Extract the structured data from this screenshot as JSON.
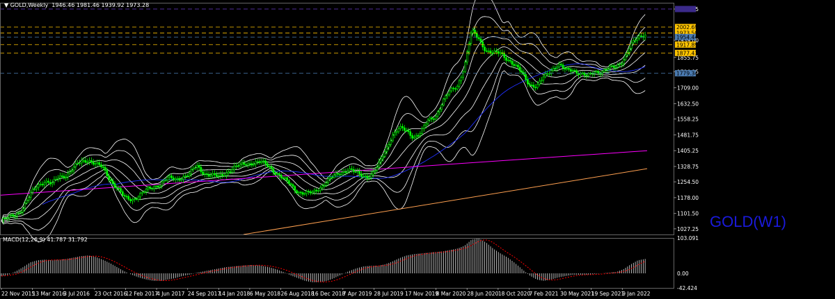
{
  "window": {
    "title": "GOLD,Weekly",
    "ohlc": "1946.46 1981.46 1939.92 1973.28",
    "watermark": "GOLD(W1)"
  },
  "colors": {
    "background": "#000000",
    "candle": "#00ff00",
    "bands": "#ffffff",
    "ma_blue": "#2030ff",
    "ma_magenta": "#ff00ff",
    "ma_orange": "#ffa050",
    "level_line": "#ffc400",
    "level_blue": "#4a7ab0",
    "macd_hist": "#c8c8c8",
    "macd_signal": "#ff0000"
  },
  "chart_data": [
    {
      "type": "candlestick",
      "title": "GOLD,Weekly 1946.46 1981.46 1939.92 1973.28",
      "ylim": [
        1000,
        2120
      ],
      "y_ticks": [
        "2089.75",
        "1939.00",
        "1855.75",
        "1786.25",
        "1709.00",
        "1632.50",
        "1558.25",
        "1481.75",
        "1405.25",
        "1328.75",
        "1254.50",
        "1178.00",
        "1101.50",
        "1027.25"
      ],
      "x_ticks": [
        "22 Nov 2015",
        "13 Mar 2016",
        "3 Jul 2016",
        "23 Oct 2016",
        "12 Feb 2017",
        "4 Jun 2017",
        "24 Sep 2017",
        "14 Jan 2018",
        "6 May 2018",
        "26 Aug 2018",
        "16 Dec 2018",
        "7 Apr 2019",
        "28 Jul 2019",
        "17 Nov 2019",
        "8 Mar 2020",
        "28 Jun 2020",
        "18 Oct 2020",
        "7 Feb 2021",
        "30 May 2021",
        "19 Sep 2021",
        "9 Jan 2022"
      ],
      "series_close": [
        1065,
        1080,
        1100,
        1130,
        1190,
        1240,
        1260,
        1240,
        1280,
        1290,
        1320,
        1350,
        1365,
        1340,
        1320,
        1270,
        1225,
        1175,
        1170,
        1190,
        1210,
        1230,
        1250,
        1270,
        1265,
        1280,
        1290,
        1330,
        1300,
        1285,
        1275,
        1300,
        1320,
        1330,
        1345,
        1350,
        1345,
        1330,
        1300,
        1265,
        1240,
        1210,
        1195,
        1200,
        1230,
        1255,
        1280,
        1305,
        1315,
        1295,
        1285,
        1285,
        1320,
        1400,
        1480,
        1510,
        1500,
        1475,
        1490,
        1550,
        1575,
        1640,
        1690,
        1720,
        1810,
        1980,
        1950,
        1890,
        1870,
        1880,
        1850,
        1810,
        1780,
        1730,
        1710,
        1760,
        1800,
        1820,
        1790,
        1800,
        1780,
        1760,
        1790,
        1790,
        1800,
        1810,
        1850,
        1910,
        1950,
        1973
      ],
      "price_levels": [
        {
          "value": 2002.69,
          "label": "2002.69",
          "color": "#ffc400"
        },
        {
          "value": 1973.5,
          "label": "1973.50",
          "color": "#ffc400"
        },
        {
          "value": 1954.44,
          "label": "1954.44",
          "color": "#4a7ab0"
        },
        {
          "value": 1917.89,
          "label": "1917.89",
          "color": "#ffc400"
        },
        {
          "value": 1877.43,
          "label": "1877.43",
          "color": "#ffc400"
        },
        {
          "value": 1779.34,
          "label": "1779.34",
          "color": "#4a7ab0"
        }
      ],
      "grid": false
    },
    {
      "type": "bar",
      "title": "MACD(12,26,9) 41.787 31.792",
      "ylim": [
        -42.424,
        103.091
      ],
      "y_ticks": [
        "103.091",
        "0.00",
        "-42.424"
      ],
      "macd_hist_line": [
        -8,
        -4,
        6,
        18,
        32,
        38,
        40,
        38,
        40,
        42,
        46,
        50,
        52,
        48,
        40,
        30,
        18,
        6,
        -4,
        -12,
        -18,
        -22,
        -22,
        -18,
        -14,
        -8,
        -4,
        2,
        6,
        10,
        14,
        18,
        20,
        22,
        24,
        24,
        22,
        18,
        12,
        4,
        -6,
        -14,
        -22,
        -26,
        -26,
        -22,
        -14,
        -4,
        6,
        14,
        20,
        22,
        22,
        26,
        34,
        44,
        52,
        56,
        58,
        60,
        62,
        64,
        68,
        72,
        80,
        98,
        102,
        90,
        72,
        58,
        46,
        30,
        12,
        -6,
        -18,
        -22,
        -18,
        -12,
        -8,
        -4,
        -4,
        -4,
        -2,
        0,
        2,
        4,
        12,
        26,
        38,
        42
      ],
      "grid": false
    }
  ]
}
